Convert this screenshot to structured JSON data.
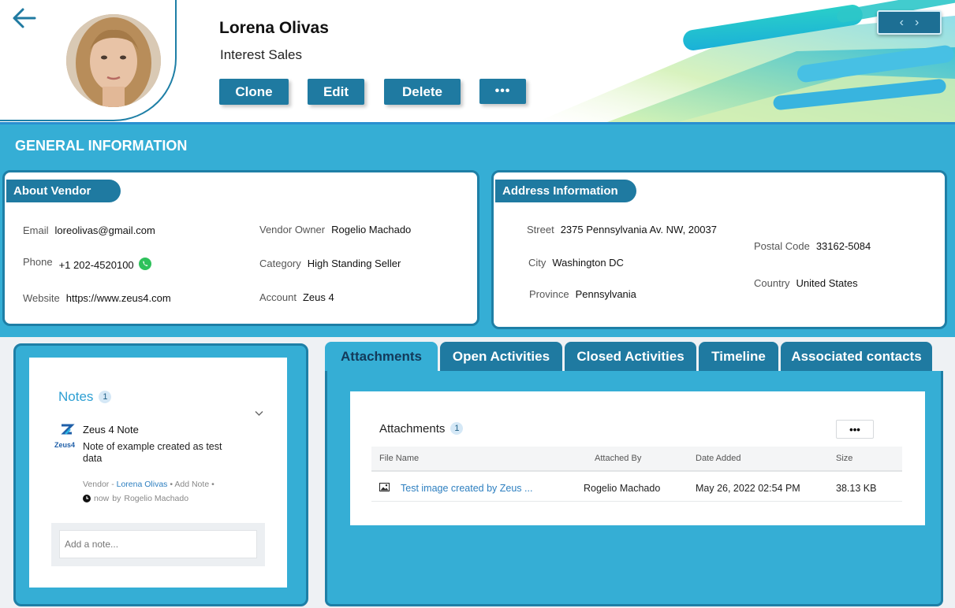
{
  "header": {
    "name": "Lorena Olivas",
    "subtitle": "Interest Sales",
    "buttons": {
      "clone": "Clone",
      "edit": "Edit",
      "delete": "Delete",
      "more": "•••"
    },
    "nav": {
      "prev": "‹",
      "next": "›"
    }
  },
  "general": {
    "title": "GENERAL INFORMATION",
    "vendor": {
      "heading": "About Vendor",
      "email": {
        "label": "Email",
        "value": "loreolivas@gmail.com"
      },
      "phone": {
        "label": "Phone",
        "value": "+1 202-4520100"
      },
      "website": {
        "label": "Website",
        "value": "https://www.zeus4.com"
      },
      "owner": {
        "label": "Vendor Owner",
        "value": "Rogelio Machado"
      },
      "category": {
        "label": "Category",
        "value": "High Standing Seller"
      },
      "account": {
        "label": "Account",
        "value": "Zeus 4"
      }
    },
    "address": {
      "heading": "Address Information",
      "street": {
        "label": "Street",
        "value": "2375 Pennsylvania Av. NW, 20037"
      },
      "city": {
        "label": "City",
        "value": "Washington DC"
      },
      "province": {
        "label": "Province",
        "value": "Pennsylvania"
      },
      "postal": {
        "label": "Postal Code",
        "value": "33162-5084"
      },
      "country": {
        "label": "Country",
        "value": "United States"
      }
    }
  },
  "notes": {
    "title": "Notes",
    "count": "1",
    "item": {
      "logo_text": "Zeus4",
      "title": "Zeus 4 Note",
      "body": "Note of example created as test data",
      "meta_prefix": "Vendor",
      "meta_sep": "-",
      "meta_link": "Lorena Olivas",
      "meta_dot1": "•",
      "meta_add": "Add Note",
      "meta_dot2": "•",
      "time": "now",
      "by": "by",
      "author": "Rogelio Machado"
    },
    "input_placeholder": "Add a note..."
  },
  "tabs": [
    "Attachments",
    "Open Activities",
    "Closed Activities",
    "Timeline",
    "Associated contacts"
  ],
  "attachments": {
    "title": "Attachments",
    "count": "1",
    "more": "•••",
    "columns": [
      "File Name",
      "Attached By",
      "Date Added",
      "Size"
    ],
    "rows": [
      {
        "file": "Test image created by Zeus ...",
        "by": "Rogelio Machado",
        "date": "May 26, 2022 02:54 PM",
        "size": "38.13 KB"
      }
    ]
  },
  "colors": {
    "accent_dark": "#1f7aa1",
    "accent_light": "#35aed5",
    "link": "#2d7fc0",
    "whatsapp": "#2ec15b"
  },
  "icons": [
    "back-arrow-icon",
    "whatsapp-icon",
    "chevron-down-icon",
    "zeus4-logo",
    "clock-icon",
    "image-file-icon",
    "chevron-left-icon",
    "chevron-right-icon"
  ]
}
